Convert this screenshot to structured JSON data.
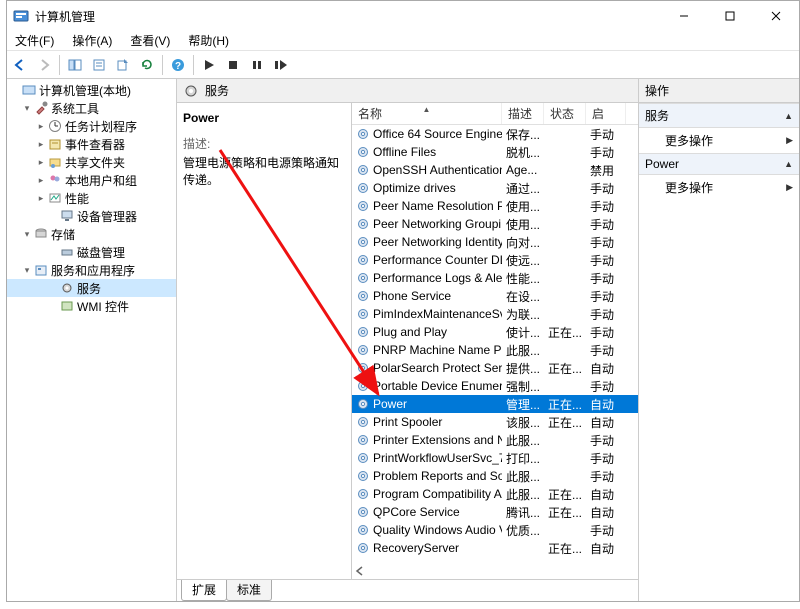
{
  "window": {
    "title": "计算机管理"
  },
  "menus": {
    "file": "文件(F)",
    "action": "操作(A)",
    "view": "查看(V)",
    "help": "帮助(H)"
  },
  "tree": {
    "root": "计算机管理(本地)",
    "systools": "系统工具",
    "scheduler": "任务计划程序",
    "eventviewer": "事件查看器",
    "shared": "共享文件夹",
    "localusers": "本地用户和组",
    "perf": "性能",
    "devmgr": "设备管理器",
    "storage": "存储",
    "diskmgmt": "磁盘管理",
    "servapps": "服务和应用程序",
    "services": "服务",
    "wmi": "WMI 控件"
  },
  "center": {
    "header": "服务",
    "svc_name": "Power",
    "desc_label": "描述:",
    "desc_text": "管理电源策略和电源策略通知传递。",
    "cols": {
      "name": "名称",
      "desc": "描述",
      "status": "状态",
      "type": "启"
    },
    "tabs": {
      "extended": "扩展",
      "standard": "标准"
    }
  },
  "actions": {
    "title": "操作",
    "sec1": "服务",
    "sec2": "Power",
    "more": "更多操作"
  },
  "services": [
    {
      "name": "Office 64 Source Engine",
      "desc": "保存...",
      "status": "",
      "type": "手动"
    },
    {
      "name": "Offline Files",
      "desc": "脱机...",
      "status": "",
      "type": "手动"
    },
    {
      "name": "OpenSSH Authentication ...",
      "desc": "Age...",
      "status": "",
      "type": "禁用"
    },
    {
      "name": "Optimize drives",
      "desc": "通过...",
      "status": "",
      "type": "手动"
    },
    {
      "name": "Peer Name Resolution Pr...",
      "desc": "使用...",
      "status": "",
      "type": "手动"
    },
    {
      "name": "Peer Networking Groupi...",
      "desc": "使用...",
      "status": "",
      "type": "手动"
    },
    {
      "name": "Peer Networking Identity...",
      "desc": "向对...",
      "status": "",
      "type": "手动"
    },
    {
      "name": "Performance Counter DL...",
      "desc": "使远...",
      "status": "",
      "type": "手动"
    },
    {
      "name": "Performance Logs & Aler...",
      "desc": "性能...",
      "status": "",
      "type": "手动"
    },
    {
      "name": "Phone Service",
      "desc": "在设...",
      "status": "",
      "type": "手动"
    },
    {
      "name": "PimIndexMaintenanceSvc...",
      "desc": "为联...",
      "status": "",
      "type": "手动"
    },
    {
      "name": "Plug and Play",
      "desc": "使计...",
      "status": "正在...",
      "type": "手动"
    },
    {
      "name": "PNRP Machine Name Pu...",
      "desc": "此服...",
      "status": "",
      "type": "手动"
    },
    {
      "name": "PolarSearch Protect Servi...",
      "desc": "提供...",
      "status": "正在...",
      "type": "自动"
    },
    {
      "name": "Portable Device Enumera...",
      "desc": "强制...",
      "status": "",
      "type": "手动"
    },
    {
      "name": "Power",
      "desc": "管理...",
      "status": "正在...",
      "type": "自动",
      "selected": true
    },
    {
      "name": "Print Spooler",
      "desc": "该服...",
      "status": "正在...",
      "type": "自动"
    },
    {
      "name": "Printer Extensions and N...",
      "desc": "此服...",
      "status": "",
      "type": "手动"
    },
    {
      "name": "PrintWorkflowUserSvc_78...",
      "desc": "打印...",
      "status": "",
      "type": "手动"
    },
    {
      "name": "Problem Reports and Sol...",
      "desc": "此服...",
      "status": "",
      "type": "手动"
    },
    {
      "name": "Program Compatibility A...",
      "desc": "此服...",
      "status": "正在...",
      "type": "自动"
    },
    {
      "name": "QPCore Service",
      "desc": "腾讯...",
      "status": "正在...",
      "type": "自动"
    },
    {
      "name": "Quality Windows Audio V...",
      "desc": "优质...",
      "status": "",
      "type": "手动"
    },
    {
      "name": "RecoveryServer",
      "desc": "",
      "status": "正在...",
      "type": "自动"
    }
  ]
}
